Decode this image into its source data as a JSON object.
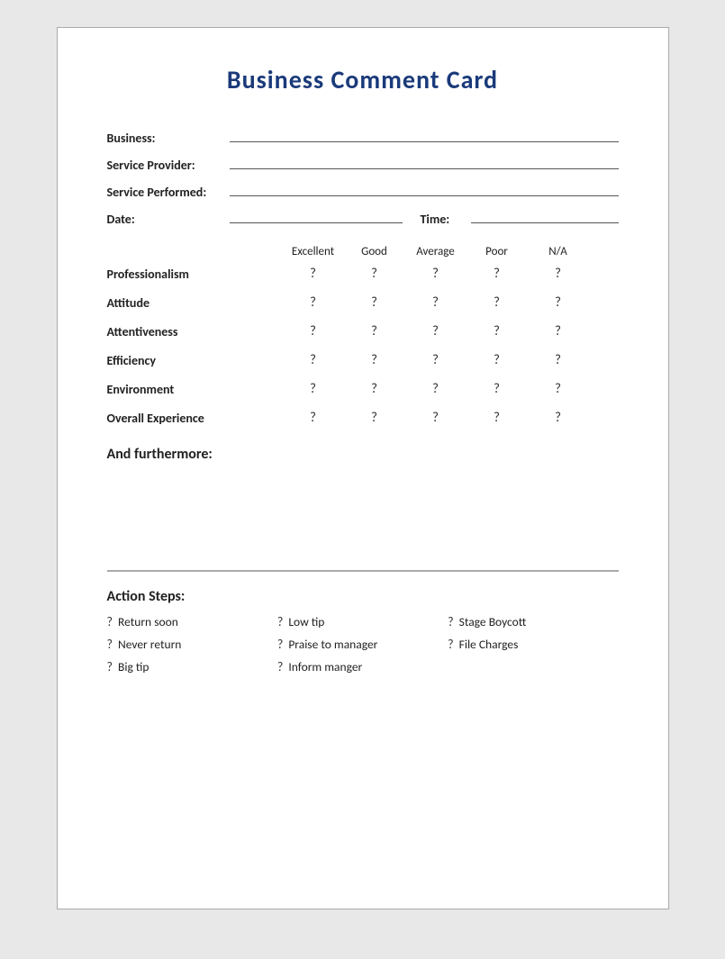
{
  "title": "Business Comment Card",
  "fields": {
    "business_label": "Business:",
    "service_provider_label": "Service Provider:",
    "service_performed_label": "Service Performed:",
    "date_label": "Date:",
    "time_label": "Time:"
  },
  "rating": {
    "headers": [
      "Excellent",
      "Good",
      "Average",
      "Poor",
      "N/A"
    ],
    "rows": [
      {
        "label": "Professionalism",
        "values": [
          "?",
          "?",
          "?",
          "?",
          "?"
        ]
      },
      {
        "label": "Attitude",
        "values": [
          "?",
          "?",
          "?",
          "?",
          "?"
        ]
      },
      {
        "label": "Attentiveness",
        "values": [
          "?",
          "?",
          "?",
          "?",
          "?"
        ]
      },
      {
        "label": "Efficiency",
        "values": [
          "?",
          "?",
          "?",
          "?",
          "?"
        ]
      },
      {
        "label": "Environment",
        "values": [
          "?",
          "?",
          "?",
          "?",
          "?"
        ]
      },
      {
        "label": "Overall Experience",
        "values": [
          "?",
          "?",
          "?",
          "?",
          "?"
        ]
      }
    ]
  },
  "furthermore": {
    "title": "And furthermore:"
  },
  "action_steps": {
    "title": "Action Steps:",
    "items": [
      {
        "icon": "?",
        "text": "Return soon"
      },
      {
        "icon": "?",
        "text": "Low tip"
      },
      {
        "icon": "?",
        "text": "Stage Boycott"
      },
      {
        "icon": "?",
        "text": "Never return"
      },
      {
        "icon": "?",
        "text": "Praise to manager"
      },
      {
        "icon": "?",
        "text": "File Charges"
      },
      {
        "icon": "?",
        "text": "Big tip"
      },
      {
        "icon": "?",
        "text": "Inform manger"
      },
      {
        "icon": "",
        "text": ""
      }
    ]
  }
}
